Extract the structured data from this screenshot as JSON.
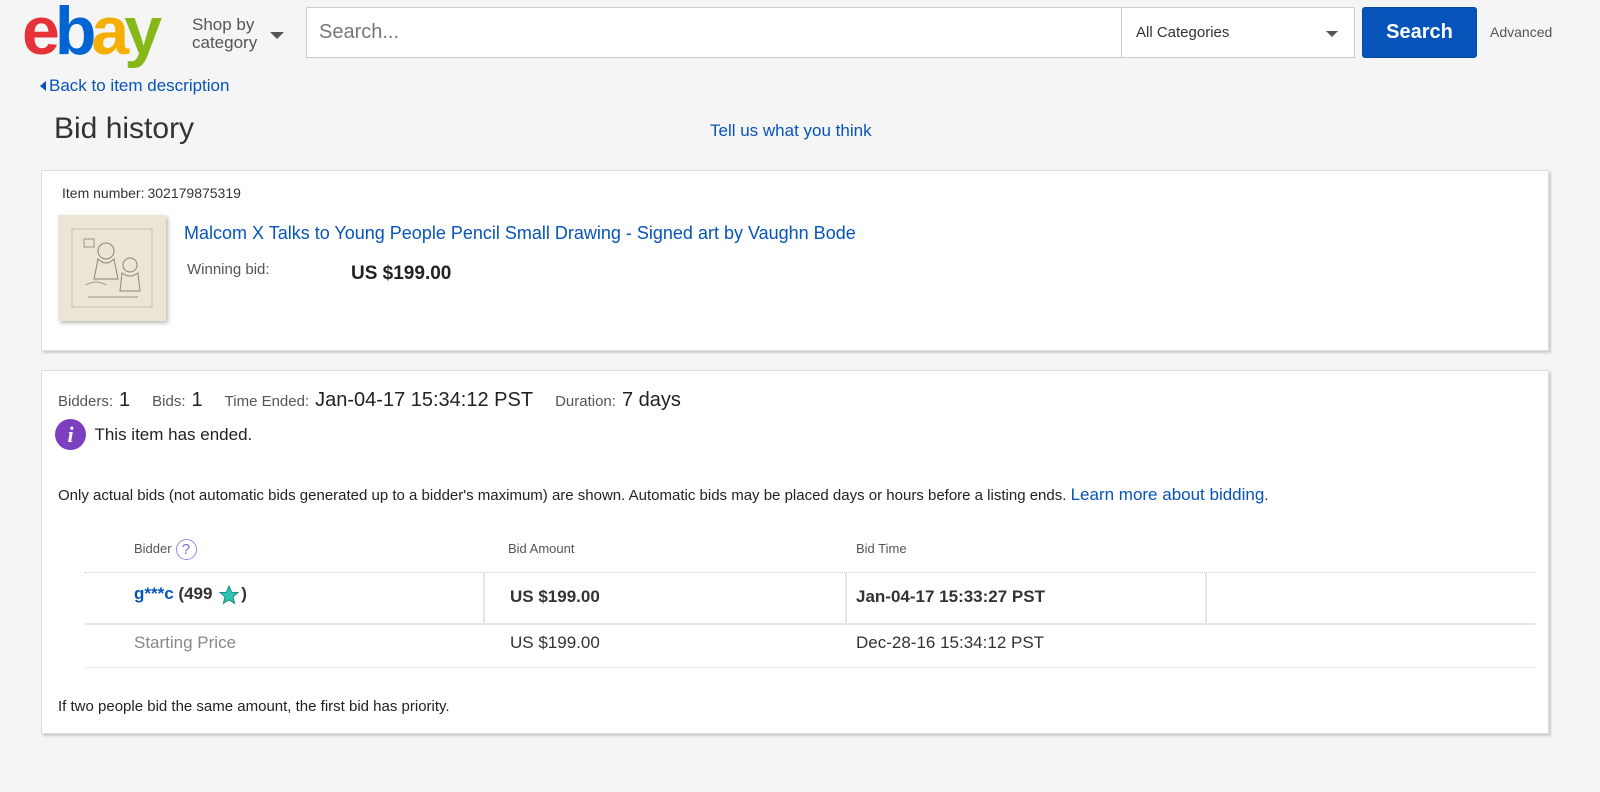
{
  "header": {
    "logo": {
      "e": "e",
      "b": "b",
      "a": "a",
      "y": "y"
    },
    "shop_by_line1": "Shop by",
    "shop_by_line2": "category",
    "search_placeholder": "Search...",
    "category_selected": "All Categories",
    "search_button": "Search",
    "advanced_link": "Advanced"
  },
  "nav": {
    "back_link": "Back to item description",
    "page_title": "Bid history",
    "feedback_link": "Tell us what you think"
  },
  "item": {
    "number_label": "Item number:",
    "number_value": "302179875319",
    "title": "Malcom X Talks to Young People Pencil Small Drawing - Signed art by Vaughn Bode",
    "winning_label": "Winning bid:",
    "winning_value": "US $199.00"
  },
  "summary": {
    "bidders_label": "Bidders:",
    "bidders_value": "1",
    "bids_label": "Bids:",
    "bids_value": "1",
    "time_ended_label": "Time Ended:",
    "time_ended_value": "Jan-04-17 15:34:12 PST",
    "duration_label": "Duration:",
    "duration_value": "7 days",
    "ended_message": "This item has ended.",
    "info_icon_glyph": "i",
    "note": "Only actual bids (not automatic bids generated up to a bidder's maximum) are shown. Automatic bids may be placed days or hours before a listing ends.",
    "learn_more": "Learn more about bidding",
    "period": "."
  },
  "table": {
    "headers": {
      "bidder": "Bidder",
      "amount": "Bid Amount",
      "time": "Bid Time"
    },
    "help_glyph": "?",
    "rows": [
      {
        "bidder": "g***c",
        "feedback_open": "(",
        "feedback_score": "499",
        "feedback_close": ")",
        "amount": "US $199.00",
        "time": "Jan-04-17 15:33:27 PST"
      },
      {
        "bidder": "Starting Price",
        "amount": "US $199.00",
        "time": "Dec-28-16 15:34:12 PST"
      }
    ],
    "footnote": "If two people bid the same amount, the first bid has priority."
  },
  "colors": {
    "link": "#0654ba",
    "button": "#0654ba",
    "info_icon": "#7b3fbf",
    "star": "#2ec4b6"
  }
}
